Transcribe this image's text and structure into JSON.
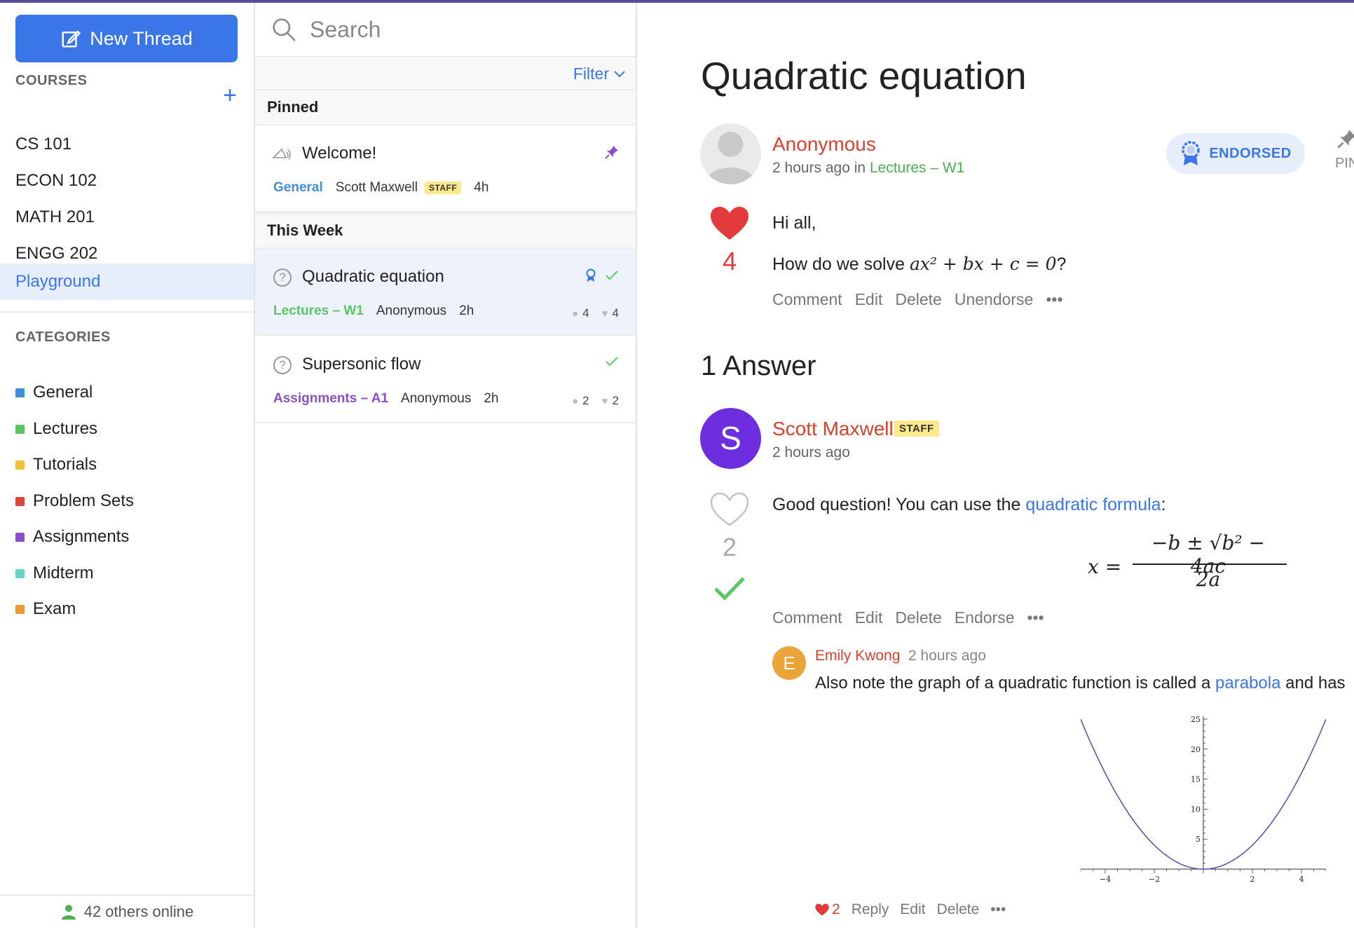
{
  "sidebar": {
    "new_thread_label": "New Thread",
    "courses_heading": "COURSES",
    "courses": [
      {
        "label": "CS 101"
      },
      {
        "label": "ECON 102"
      },
      {
        "label": "MATH 201"
      },
      {
        "label": "ENGG 202"
      },
      {
        "label": "Playground",
        "active": true
      }
    ],
    "categories_heading": "CATEGORIES",
    "categories": [
      {
        "label": "General",
        "color": "#3d8fd8"
      },
      {
        "label": "Lectures",
        "color": "#5bc764"
      },
      {
        "label": "Tutorials",
        "color": "#f0c23a"
      },
      {
        "label": "Problem Sets",
        "color": "#d8473a"
      },
      {
        "label": "Assignments",
        "color": "#8b4fc7"
      },
      {
        "label": "Midterm",
        "color": "#6ad3c7"
      },
      {
        "label": "Exam",
        "color": "#ec9a38"
      }
    ],
    "online_text": "42 others online"
  },
  "list": {
    "search_placeholder": "Search",
    "filter_label": "Filter",
    "groups": [
      {
        "heading": "Pinned"
      },
      {
        "heading": "This Week"
      }
    ],
    "threads": [
      {
        "title": "Welcome!",
        "category": "General",
        "category_color": "#3d8fd8",
        "author": "Scott Maxwell",
        "badge": "STAFF",
        "time": "4h"
      },
      {
        "title": "Quadratic equation",
        "category": "Lectures – W1",
        "category_color": "#5bc764",
        "author": "Anonymous",
        "time": "2h",
        "comments": "4",
        "likes": "4"
      },
      {
        "title": "Supersonic flow",
        "category": "Assignments – A1",
        "category_color": "#8b4fc7",
        "author": "Anonymous",
        "time": "2h",
        "comments": "2",
        "likes": "2"
      }
    ]
  },
  "thread": {
    "title": "Quadratic equation",
    "author": "Anonymous",
    "meta_prefix": "2 hours ago in",
    "meta_category": "Lectures – W1",
    "endorsed_label": "ENDORSED",
    "pin_label": "PIN",
    "votes": "4",
    "body_line1": "Hi all,",
    "body_line2_prefix": "How do we solve",
    "body_line2_math": "ax² + bx + c = 0",
    "body_line2_suffix": "?",
    "actions": [
      "Comment",
      "Edit",
      "Delete",
      "Unendorse",
      "•••"
    ]
  },
  "answers": {
    "heading": "1 Answer",
    "answer": {
      "avatar_letter": "S",
      "author": "Scott Maxwell",
      "badge": "STAFF",
      "time": "2 hours ago",
      "votes": "2",
      "text_prefix": "Good question! You can use the",
      "text_link": "quadratic formula",
      "text_suffix": ":",
      "formula_lhs": "x =",
      "formula_num": "−b ± √b² − 4ac",
      "formula_den": "2a",
      "actions": [
        "Comment",
        "Edit",
        "Delete",
        "Endorse",
        "•••"
      ],
      "comment": {
        "avatar_letter": "E",
        "author": "Emily Kwong",
        "time": "2 hours ago",
        "text_prefix": "Also note the graph of a quadratic function is called a",
        "text_link": "parabola",
        "text_suffix": "and has",
        "likes": "2",
        "actions": [
          "Reply",
          "Edit",
          "Delete",
          "•••"
        ]
      }
    }
  },
  "chart_data": {
    "type": "line",
    "series": [
      {
        "x": [
          -5,
          -4,
          -3,
          -2,
          -1,
          0,
          1,
          2,
          3,
          4,
          5
        ],
        "y": [
          25,
          16,
          9,
          4,
          1,
          0,
          1,
          4,
          9,
          16,
          25
        ]
      }
    ],
    "xticks": [
      "−4",
      "−2",
      "2",
      "4"
    ],
    "yticks": [
      "5",
      "10",
      "15",
      "20",
      "25"
    ],
    "xlim": [
      -5,
      5
    ],
    "ylim": [
      0,
      25
    ],
    "color": "#5b56a8"
  }
}
